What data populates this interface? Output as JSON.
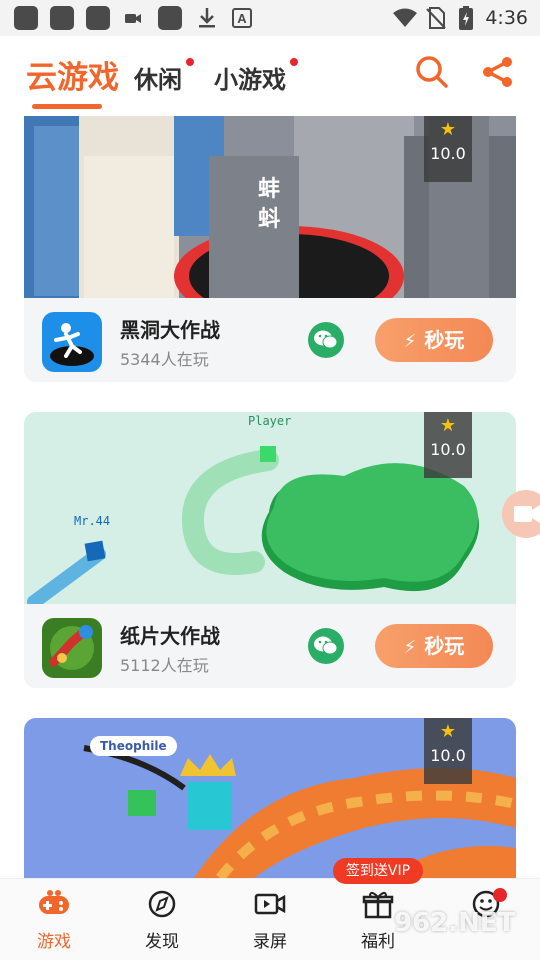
{
  "status_bar": {
    "time": "4:36",
    "icons": [
      "notification-square-1",
      "notification-square-2",
      "notification-square-3",
      "video-icon",
      "notification-square-4",
      "download-icon",
      "a-icon",
      "wifi-icon",
      "no-sim-icon",
      "battery-icon"
    ]
  },
  "top_nav": {
    "tabs": [
      {
        "label": "云游戏",
        "active": true
      },
      {
        "label": "休闲",
        "active": false,
        "has_dot": true
      },
      {
        "label": "小游戏",
        "active": false,
        "has_dot": true
      }
    ],
    "accent_color": "#f2662b"
  },
  "games": [
    {
      "name": "黑洞大作战",
      "players": "5344人在玩",
      "rating": "10.0",
      "play_label": "秒玩"
    },
    {
      "name": "纸片大作战",
      "players": "5112人在玩",
      "rating": "10.0",
      "play_label": "秒玩",
      "screenshot_labels": [
        "Player",
        "Mr.44"
      ]
    },
    {
      "name": "",
      "players": "",
      "rating": "10.0",
      "screenshot_labels": [
        "Theophile"
      ]
    }
  ],
  "bottom_nav": {
    "items": [
      {
        "label": "游戏",
        "icon": "gamepad-icon",
        "active": true
      },
      {
        "label": "发现",
        "icon": "compass-icon",
        "active": false
      },
      {
        "label": "录屏",
        "icon": "video-record-icon",
        "active": false
      },
      {
        "label": "福利",
        "icon": "gift-icon",
        "active": false
      },
      {
        "label": "",
        "icon": "smiley-icon",
        "active": false
      }
    ],
    "vip_badge": "签到送VIP"
  },
  "watermark": "962.NET"
}
